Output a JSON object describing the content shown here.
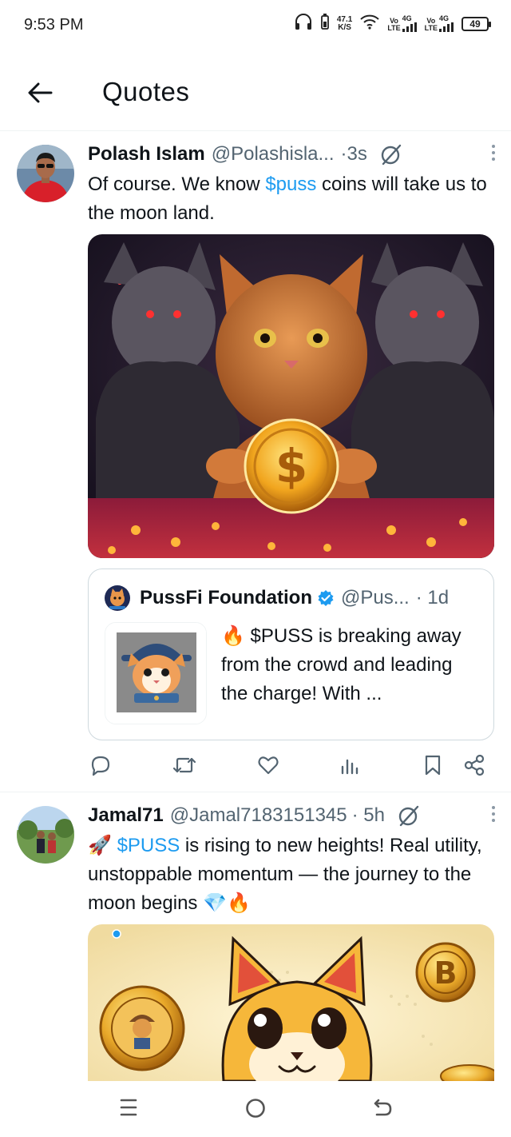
{
  "status_bar": {
    "time": "9:53 PM",
    "net_speed_value": "47.1",
    "net_speed_unit": "K/S",
    "sim1_label": "Vo\nLTE",
    "sim1_net": "4G",
    "sim2_label": "Vo\nLTE",
    "sim2_net": "4G",
    "battery": "49"
  },
  "header": {
    "title": "Quotes"
  },
  "tweets": [
    {
      "name": "Polash Islam",
      "handle": "@Polashisla...",
      "time": "·3s",
      "text_before": "Of course. We know ",
      "cashtag": "$puss",
      "text_after": " coins will take us to the moon land.",
      "media_alt": "orange-cat-holding-gold-dollar-coin",
      "quote": {
        "name": "PussFi Foundation",
        "handle": "@Pus...",
        "time": "· 1d",
        "text": "🔥 $PUSS is breaking away from the crowd and leading the charge! With ..."
      }
    },
    {
      "name": "Jamal71",
      "handle": "@Jamal7183151345",
      "time": "· 5h",
      "text_prefix": "🚀 ",
      "cashtag": "$PUSS",
      "text_after": " is rising to new heights! Real utility, unstoppable momentum — the journey to the moon begins 💎🔥",
      "media_alt": "cartoon-cat-with-bitcoins"
    }
  ],
  "icons": {
    "back": "arrow-left-icon",
    "grok": "grok-icon",
    "more": "more-vertical-icon",
    "reply": "reply-icon",
    "retweet": "retweet-icon",
    "like": "like-icon",
    "views": "views-icon",
    "bookmark": "bookmark-icon",
    "share": "share-icon"
  },
  "colors": {
    "accent": "#1d9bf0",
    "text": "#0f1419",
    "secondary": "#536471",
    "border": "#cfd9de"
  }
}
